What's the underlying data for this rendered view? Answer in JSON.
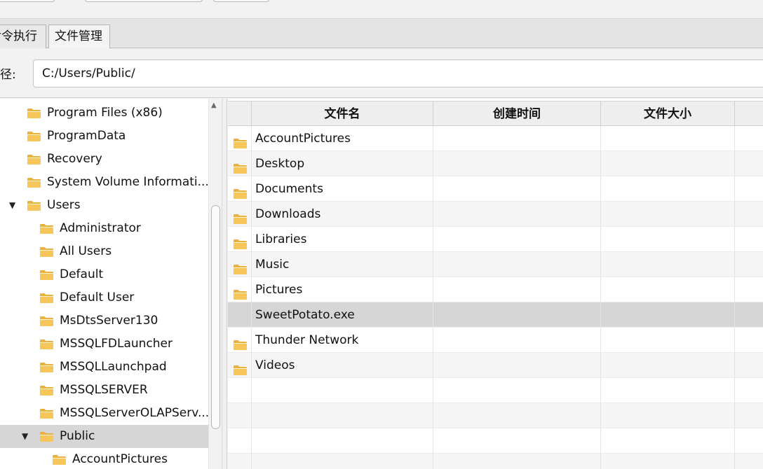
{
  "tabs": [
    {
      "label": "命令执行",
      "active": false
    },
    {
      "label": "文件管理",
      "active": true
    }
  ],
  "path": {
    "label": "路径:",
    "value": "C:/Users/Public/"
  },
  "tree": {
    "items": [
      {
        "label": "Program Files (x86)",
        "expanded": null,
        "selected": false
      },
      {
        "label": "ProgramData",
        "expanded": null,
        "selected": false
      },
      {
        "label": "Recovery",
        "expanded": null,
        "selected": false
      },
      {
        "label": "System Volume Informati...",
        "expanded": null,
        "selected": false
      },
      {
        "label": "Users",
        "expanded": true,
        "selected": false
      },
      {
        "label": "Administrator",
        "expanded": null,
        "selected": false
      },
      {
        "label": "All Users",
        "expanded": null,
        "selected": false
      },
      {
        "label": "Default",
        "expanded": null,
        "selected": false
      },
      {
        "label": "Default User",
        "expanded": null,
        "selected": false
      },
      {
        "label": "MsDtsServer130",
        "expanded": null,
        "selected": false
      },
      {
        "label": "MSSQLFDLauncher",
        "expanded": null,
        "selected": false
      },
      {
        "label": "MSSQLLaunchpad",
        "expanded": null,
        "selected": false
      },
      {
        "label": "MSSQLSERVER",
        "expanded": null,
        "selected": false
      },
      {
        "label": "MSSQLServerOLAPServ...",
        "expanded": null,
        "selected": false
      },
      {
        "label": "Public",
        "expanded": true,
        "selected": true
      },
      {
        "label": "AccountPictures",
        "expanded": null,
        "selected": false
      }
    ]
  },
  "table": {
    "columns": [
      "文件名",
      "创建时间",
      "文件大小"
    ],
    "rows": [
      {
        "name": "AccountPictures",
        "created": "",
        "size": "",
        "icon": "folder-icon"
      },
      {
        "name": "Desktop",
        "created": "",
        "size": "",
        "icon": "folder-icon"
      },
      {
        "name": "Documents",
        "created": "",
        "size": "",
        "icon": "folder-icon"
      },
      {
        "name": "Downloads",
        "created": "",
        "size": "",
        "icon": "folder-icon"
      },
      {
        "name": "Libraries",
        "created": "",
        "size": "",
        "icon": "folder-icon"
      },
      {
        "name": "Music",
        "created": "",
        "size": "",
        "icon": "folder-icon"
      },
      {
        "name": "Pictures",
        "created": "",
        "size": "",
        "icon": "folder-icon"
      },
      {
        "name": "SweetPotato.exe",
        "created": "",
        "size": "",
        "icon": "",
        "selected": true
      },
      {
        "name": "Thunder Network",
        "created": "",
        "size": "",
        "icon": "folder-icon"
      },
      {
        "name": "Videos",
        "created": "",
        "size": "",
        "icon": "folder-icon"
      }
    ],
    "empty_rows": 4
  },
  "colors": {
    "folder_fill": "#f6c65b",
    "folder_tab": "#e9b23e",
    "selection": "#d6d6d6"
  }
}
